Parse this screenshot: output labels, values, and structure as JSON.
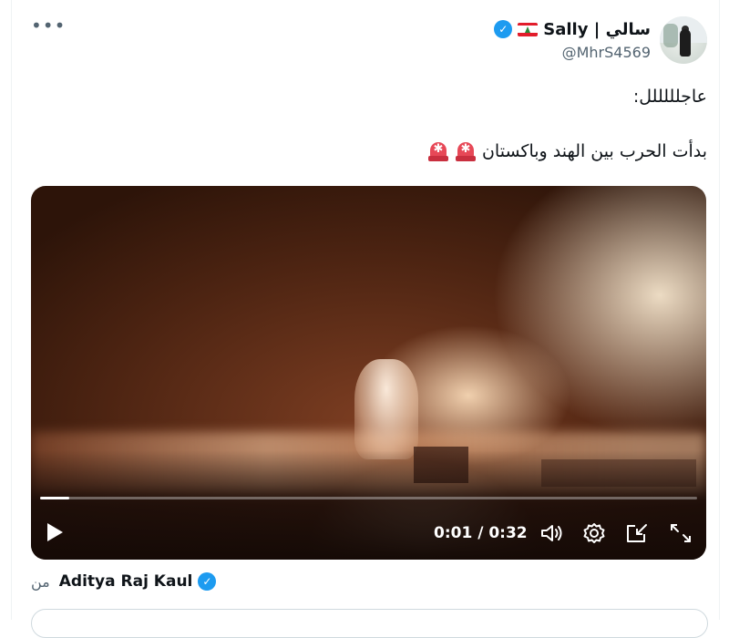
{
  "tweet": {
    "author": {
      "display_name": "Sally | سالي",
      "handle": "@MhrS4569",
      "verified": true,
      "flag_icon": "lebanon-flag-icon",
      "verified_color": "#1d9bf0"
    },
    "more_label": "•••",
    "text_line1": "عاجلللللل:",
    "text_line2": "بدأت الحرب بين الهند وباكستان"
  },
  "video": {
    "current_time": "0:01 / 0:32",
    "progress_fraction": 0.045,
    "controls": [
      "play-icon",
      "volume-icon",
      "settings-gear-icon",
      "picture-in-picture-icon",
      "fullscreen-icon"
    ]
  },
  "from": {
    "label": "من",
    "name": "Aditya Raj Kaul",
    "verified": true
  }
}
